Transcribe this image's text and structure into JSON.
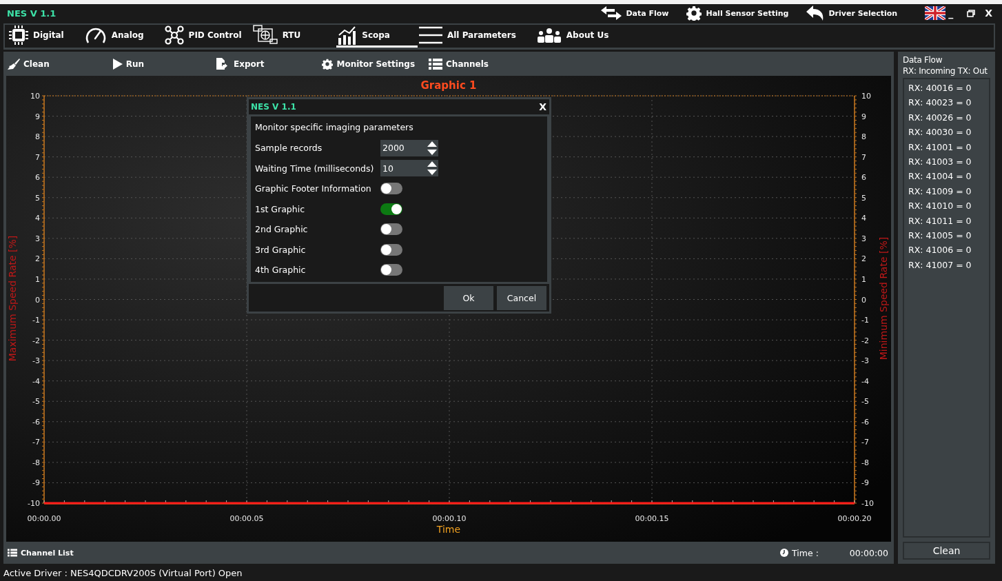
{
  "window": {
    "title": "NES V 1.1",
    "top_actions": [
      {
        "kind": "swap",
        "label": "Data Flow"
      },
      {
        "kind": "gear",
        "label": "Hall Sensor Setting"
      },
      {
        "kind": "back",
        "label": "Driver Selection"
      }
    ],
    "minimize": "_",
    "close": "X"
  },
  "tabs": [
    {
      "label": "Digital",
      "selected": false
    },
    {
      "label": "Analog",
      "selected": false
    },
    {
      "label": "PID Control",
      "selected": false
    },
    {
      "label": "RTU",
      "selected": false
    },
    {
      "label": "Scopa",
      "selected": true
    },
    {
      "label": "All Parameters",
      "selected": false
    },
    {
      "label": "About Us",
      "selected": false
    }
  ],
  "toolbar": [
    "Clean",
    "Run",
    "Export",
    "Monitor Settings",
    "Channels"
  ],
  "chart": {
    "right_ylabel": "Minimum Speed Rate [%]",
    "right_yticks": [
      "10",
      "9",
      "8",
      "7",
      "6",
      "5",
      "4",
      "3",
      "2",
      "1",
      "0",
      "-1",
      "-2",
      "-3",
      "-4",
      "-5",
      "-6",
      "-7",
      "-8",
      "-9",
      "-10"
    ],
    "chart_data": {
      "type": "line",
      "title": "Graphic 1",
      "xlabel": "Time",
      "ylabel": "Maximum Speed Rate [%]",
      "categories": [
        "00:00.00",
        "00:00.05",
        "00:00.10",
        "00:00.15",
        "00:00.20"
      ],
      "series": [
        {
          "color": "#ff1a1a",
          "values": [
            -10,
            -10,
            -10,
            -10,
            -10
          ]
        }
      ],
      "ylim": [
        -10,
        10
      ],
      "grid": true,
      "yticks": [
        10,
        9,
        8,
        7,
        6,
        5,
        4,
        3,
        2,
        1,
        0,
        -1,
        -2,
        -3,
        -4,
        -5,
        -6,
        -7,
        -8,
        -9,
        -10
      ]
    }
  },
  "dialog": {
    "title": "NES V 1.1",
    "close": "X",
    "heading": "Monitor specific imaging parameters",
    "rows": [
      {
        "kind": "spinner",
        "label": "Sample records",
        "value": "2000"
      },
      {
        "kind": "spinner",
        "label": "Waiting Time (milliseconds)",
        "value": "10"
      },
      {
        "kind": "toggle",
        "label": "Graphic Footer Information",
        "on": false
      },
      {
        "kind": "toggle",
        "label": "1st Graphic",
        "on": true
      },
      {
        "kind": "toggle",
        "label": "2nd Graphic",
        "on": false
      },
      {
        "kind": "toggle",
        "label": "3rd Graphic",
        "on": false
      },
      {
        "kind": "toggle",
        "label": "4th Graphic",
        "on": false
      }
    ],
    "buttons": [
      "Ok",
      "Cancel"
    ]
  },
  "channel_bar": {
    "label": "Channel List",
    "time_label": "Time :",
    "time_value": "00:00:00"
  },
  "data_flow": {
    "title": "Data Flow",
    "subtitle": "RX: Incoming TX: Out",
    "entries": [
      "RX: 40016 = 0",
      "RX: 40023 = 0",
      "RX: 40026 = 0",
      "RX: 40030 = 0",
      "RX: 41001 = 0",
      "RX: 41003 = 0",
      "RX: 41004 = 0",
      "RX: 41009 = 0",
      "RX: 41010 = 0",
      "RX: 41011 = 0",
      "RX: 41005 = 0",
      "RX: 41006 = 0",
      "RX: 41007 = 0"
    ],
    "button": "Clean"
  },
  "status_bar": "Active Driver : NES4QDCDRV200S (Virtual Port) Open"
}
